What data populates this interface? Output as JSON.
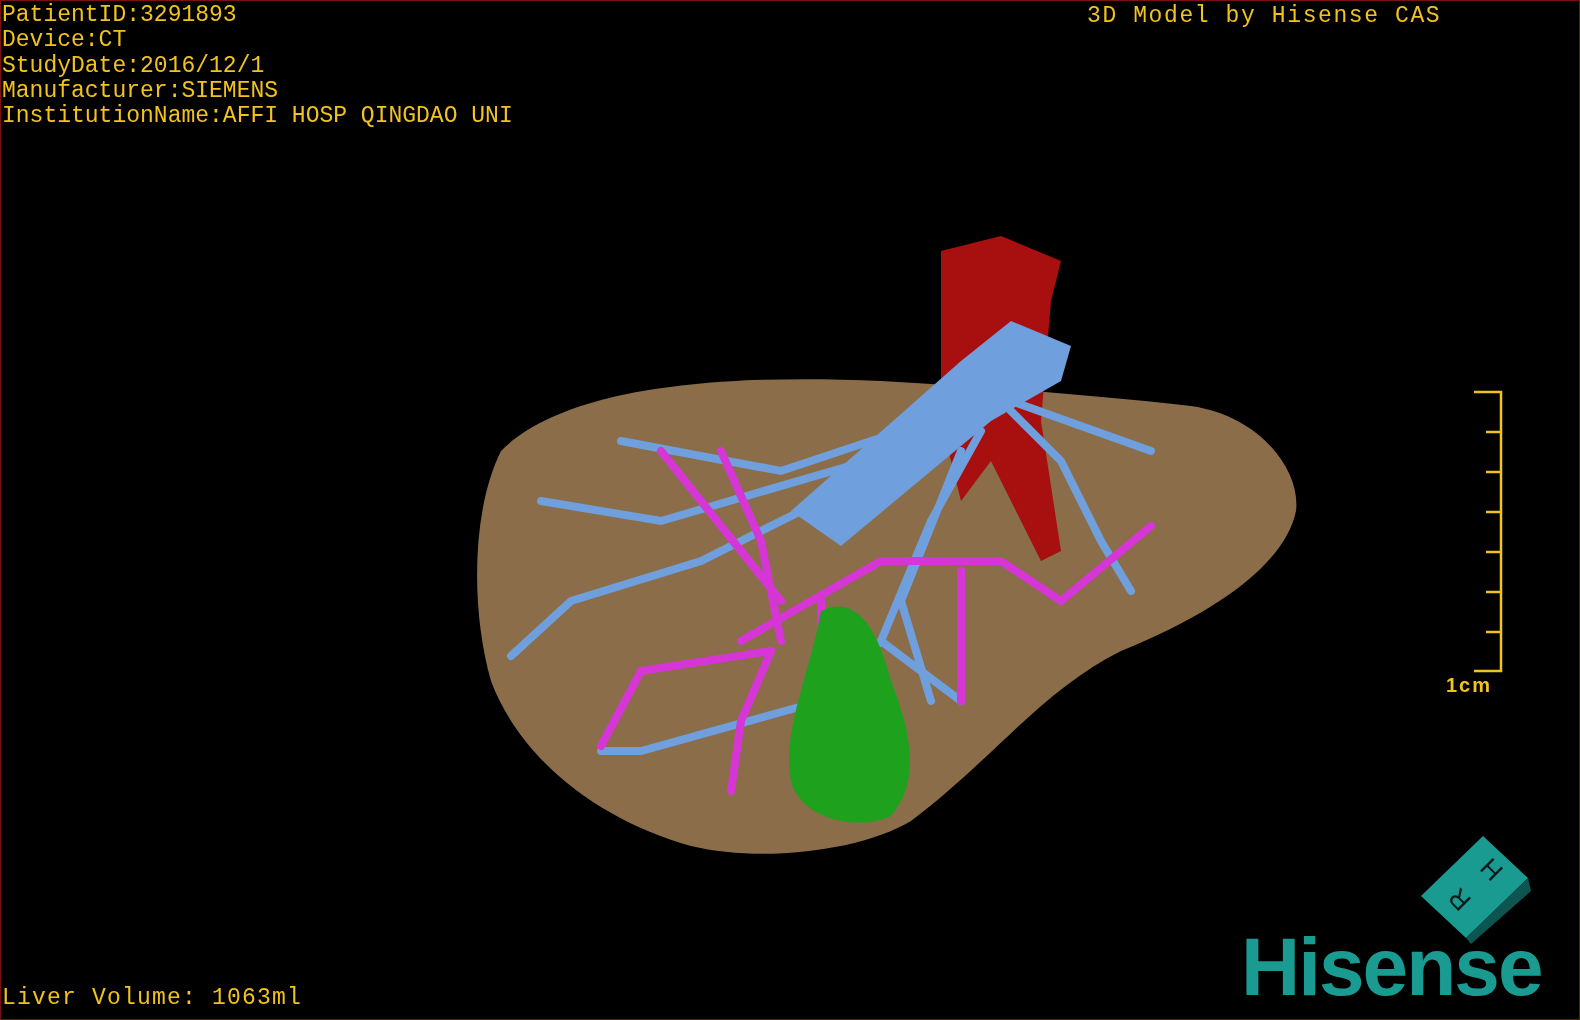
{
  "patient_info": [
    "PatientID:3291893",
    "Device:CT",
    "StudyDate:2016/12/1",
    "Manufacturer:SIEMENS",
    "InstitutionName:AFFI HOSP QINGDAO UNI"
  ],
  "title": "3D Model by Hisense CAS",
  "scale_bar": {
    "label": "1cm"
  },
  "orientation_cube": {
    "labels": [
      "H",
      "R"
    ]
  },
  "logo": "Hisense",
  "liver_volume": "Liver Volume: 1063ml"
}
